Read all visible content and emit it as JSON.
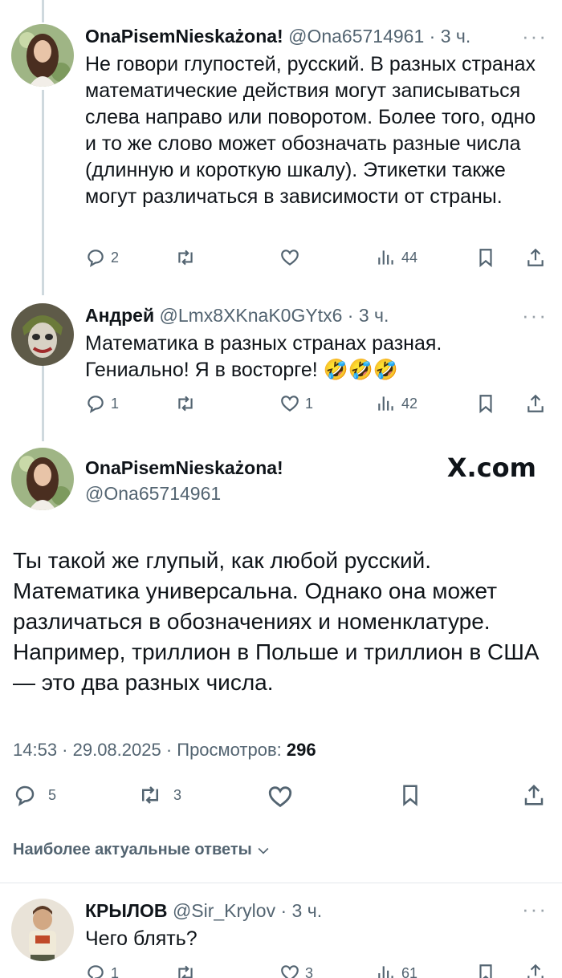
{
  "tweet1": {
    "name": "OnaPisemNieskażona!",
    "handle": "@Ona65714961",
    "time": "· 3 ч.",
    "more": "···",
    "text": "Не говори глупостей, русский. В разных странах математические действия могут записываться слева направо или поворотом. Более того, одно и то же слово может обозначать разные числа (длинную и короткую шкалу). Этикетки также могут различаться в зависимости от страны.",
    "replies": "2",
    "retweets": "",
    "likes": "",
    "views": "44"
  },
  "tweet2": {
    "name": "Андрей",
    "handle": "@Lmx8XKnaK0GYtx6",
    "time": "· 3 ч.",
    "more": "···",
    "text": "Математика в разных странах разная. Гениально! Я в восторге! 🤣🤣🤣",
    "replies": "1",
    "retweets": "",
    "likes": "1",
    "views": "42"
  },
  "main": {
    "name": "OnaPisemNieskażona!",
    "handle": "@Ona65714961",
    "brand": "X.com",
    "text": "Ты такой же глупый, как любой русский. Математика универсальна. Однако она может различаться в обозначениях и номенклатуре. Например, триллион в Польше и триллион в США — это два разных числа.",
    "timestamp": "14:53 · 29.08.2025 · Просмотров:",
    "views": "296",
    "replies": "5",
    "retweets": "3"
  },
  "sort_label": "Наиболее актуальные ответы",
  "tweet3": {
    "name": "КРЫЛОВ",
    "handle": "@Sir_Krylov",
    "time": "· 3 ч.",
    "more": "···",
    "text": "Чего блять?",
    "replies": "1",
    "likes": "3",
    "views": "61"
  },
  "colors": {
    "text": "#0f1419",
    "secondary": "#536471",
    "thread_line": "#cfd9de"
  },
  "icons": [
    "reply-icon",
    "retweet-icon",
    "like-icon",
    "views-icon",
    "bookmark-icon",
    "share-icon",
    "chevron-down-icon",
    "more-icon"
  ]
}
